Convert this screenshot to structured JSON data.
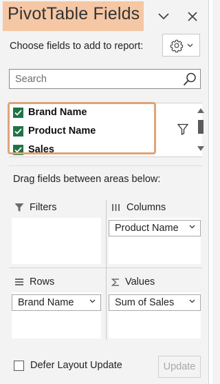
{
  "header": {
    "title": "PivotTable Fields",
    "chevron_icon": "chevron-down-icon",
    "close_icon": "close-icon"
  },
  "toolbar": {
    "choose_label": "Choose fields to add to report:",
    "gear_icon": "gear-icon"
  },
  "search": {
    "placeholder": "Search",
    "value": ""
  },
  "fields": [
    {
      "label": "Brand Name",
      "checked": true
    },
    {
      "label": "Product Name",
      "checked": true
    },
    {
      "label": "Sales",
      "checked": true
    }
  ],
  "drag_hint": "Drag fields between areas below:",
  "areas": {
    "filters": {
      "label": "Filters",
      "items": []
    },
    "columns": {
      "label": "Columns",
      "items": [
        "Product Name"
      ]
    },
    "rows": {
      "label": "Rows",
      "items": [
        "Brand Name"
      ]
    },
    "values": {
      "label": "Values",
      "items": [
        "Sum of Sales"
      ]
    }
  },
  "footer": {
    "defer_label": "Defer Layout Update",
    "defer_checked": false,
    "update_label": "Update"
  },
  "colors": {
    "accent_green": "#217346",
    "highlight_orange": "#f5c7a4",
    "highlight_border": "#e0a276"
  }
}
